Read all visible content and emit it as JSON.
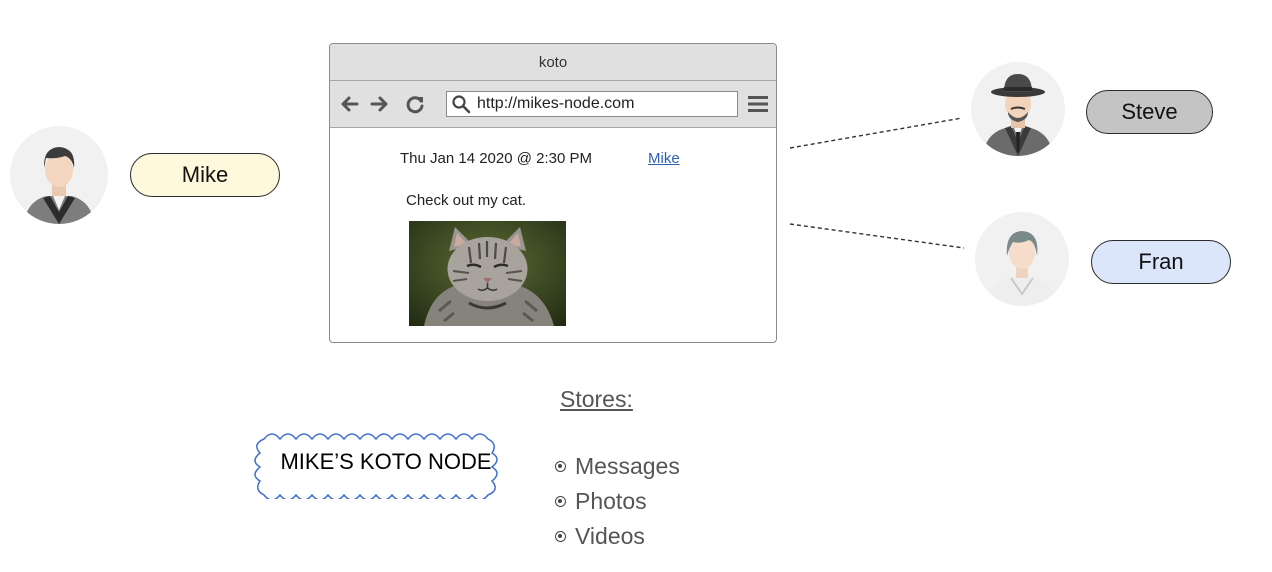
{
  "users": {
    "mike": {
      "name": "Mike",
      "pill_color": "#fef9dc"
    },
    "steve": {
      "name": "Steve",
      "pill_color": "#c4c4c4"
    },
    "fran": {
      "name": "Fran",
      "pill_color": "#dbe6fb"
    }
  },
  "browser": {
    "title": "koto",
    "url": "http://mikes-node.com",
    "post": {
      "timestamp": "Thu Jan 14 2020 @ 2:30 PM",
      "author": "Mike",
      "text": "Check out my cat."
    }
  },
  "node": {
    "label": "MIKE’S KOTO NODE"
  },
  "stores": {
    "heading": "Stores:",
    "items": [
      "Messages",
      "Photos",
      "Videos"
    ]
  },
  "colors": {
    "cloud_stroke": "#3d6fd0",
    "link": "#2f5fb3",
    "connector": "#333333"
  },
  "icons": [
    "back-arrow-icon",
    "forward-arrow-icon",
    "reload-icon",
    "search-icon",
    "hamburger-menu-icon",
    "radio-bullet-icon"
  ]
}
